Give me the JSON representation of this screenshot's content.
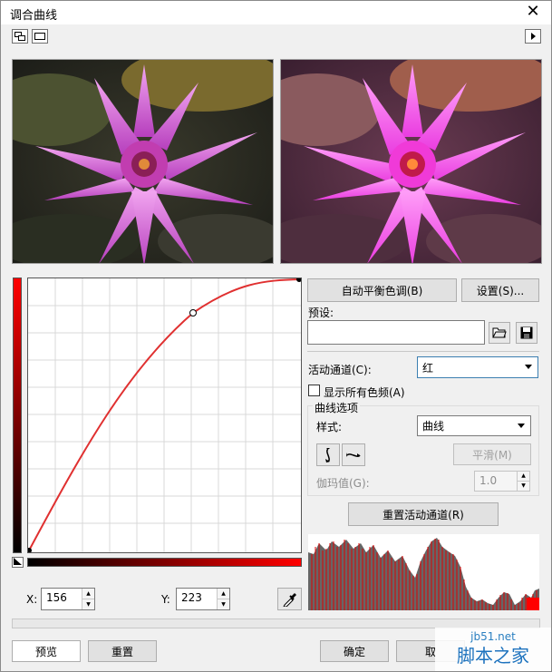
{
  "window": {
    "title": "调合曲线",
    "close_glyph": "✕"
  },
  "toolbar": {
    "left_btn1_icon": "split-view-icon",
    "left_btn2_icon": "single-view-icon",
    "right_btn_icon": "play-arrow-icon"
  },
  "buttons": {
    "auto_balance": "自动平衡色调(B)",
    "settings": "设置(S)...",
    "reset_channel": "重置活动通道(R)",
    "smooth": "平滑(M)",
    "preview": "预览",
    "reset": "重置",
    "ok": "确定",
    "cancel": "取"
  },
  "preset": {
    "label": "预设:",
    "value": ""
  },
  "channel": {
    "label": "活动通道(C):",
    "value": "红"
  },
  "show_all": {
    "label": "显示所有色频(A)",
    "checked": false
  },
  "curve_options": {
    "group_label": "曲线选项",
    "style_label": "样式:",
    "style_value": "曲线",
    "gamma_label": "伽玛值(G):",
    "gamma_value": "1.0"
  },
  "coords": {
    "x_label": "X:",
    "x_value": "156",
    "y_label": "Y:",
    "y_value": "223"
  },
  "watermark": {
    "site": "jb51.net",
    "name": "脚本之家"
  },
  "colors": {
    "curve": "#e03030",
    "accent_blue": "#3c7fb1"
  }
}
